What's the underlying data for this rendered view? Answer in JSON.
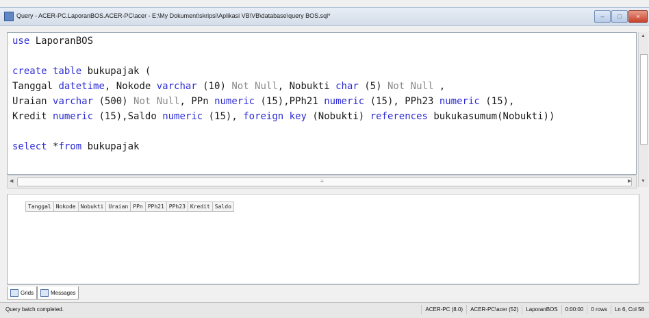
{
  "window": {
    "title": "Query - ACER-PC.LaporanBOS.ACER-PC\\acer - E:\\My Dokument\\skripsi\\Aplikasi VB\\VB\\database\\query BOS.sql*",
    "min_label": "–",
    "max_label": "□",
    "close_label": "×"
  },
  "editor": {
    "line1": {
      "kw": "use",
      "rest": " LaporanBOS"
    },
    "line3": {
      "kw": "create table",
      "rest": " bukupajak ("
    },
    "line4": {
      "a": "Tanggal ",
      "b": "datetime",
      "c": ", Nokode ",
      "d": "varchar",
      "e": " (10) ",
      "f": "Not Null",
      "g": ", Nobukti ",
      "h": "char",
      "i": " (5) ",
      "j": "Not Null",
      "k": " ,"
    },
    "line5": {
      "a": "Uraian ",
      "b": "varchar",
      "c": " (500) ",
      "d": "Not Null",
      "e": ", PPn ",
      "f": "numeric",
      "g": " (15),PPh21 ",
      "h": "numeric",
      "i": " (15), PPh23 ",
      "j": "numeric",
      "k": " (15),"
    },
    "line6": {
      "a": "Kredit ",
      "b": "numeric",
      "c": " (15),Saldo ",
      "d": "numeric",
      "e": " (15), ",
      "f": "foreign key",
      "g": " (Nobukti) ",
      "h": "references",
      "i": " bukukasumum(Nobukti))"
    },
    "line8": {
      "kw": "select",
      "star": " *",
      "kw2": "from",
      "rest": " bukupajak"
    }
  },
  "results": {
    "columns": [
      "Tanggal",
      "Nokode",
      "Nobukti",
      "Uraian",
      "PPn",
      "PPh21",
      "PPh23",
      "Kredit",
      "Saldo"
    ]
  },
  "tabs": [
    {
      "label": "Grids",
      "icon": "grid-icon"
    },
    {
      "label": "Messages",
      "icon": "messages-icon"
    }
  ],
  "status": {
    "message": "Query batch completed.",
    "server": "ACER-PC (8.0)",
    "user": "ACER-PC\\acer (52)",
    "database": "LaporanBOS",
    "time": "0:00:00",
    "rows": "0 rows",
    "position": "Ln 6, Col 58"
  }
}
